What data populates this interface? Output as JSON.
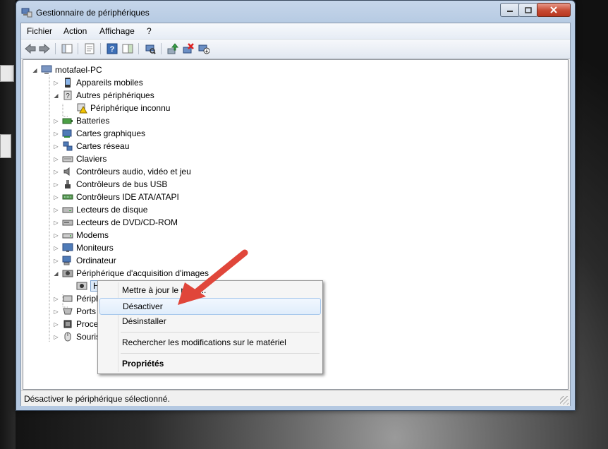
{
  "window": {
    "title": "Gestionnaire de périphériques"
  },
  "menubar": [
    "Fichier",
    "Action",
    "Affichage",
    "?"
  ],
  "tree": {
    "root": "motafael-PC",
    "items": [
      {
        "label": "Appareils mobiles",
        "icon": "mobile-device-icon"
      },
      {
        "label": "Autres périphériques",
        "icon": "unknown-device-icon"
      },
      {
        "label": "Périphérique inconnu",
        "icon": "warning-device-icon"
      },
      {
        "label": "Batteries",
        "icon": "battery-icon"
      },
      {
        "label": "Cartes graphiques",
        "icon": "display-adapter-icon"
      },
      {
        "label": "Cartes réseau",
        "icon": "network-adapter-icon"
      },
      {
        "label": "Claviers",
        "icon": "keyboard-icon"
      },
      {
        "label": "Contrôleurs audio, vidéo et jeu",
        "icon": "speaker-icon"
      },
      {
        "label": "Contrôleurs de bus USB",
        "icon": "usb-icon"
      },
      {
        "label": "Contrôleurs IDE ATA/ATAPI",
        "icon": "ide-controller-icon"
      },
      {
        "label": "Lecteurs de disque",
        "icon": "disk-drive-icon"
      },
      {
        "label": "Lecteurs de DVD/CD-ROM",
        "icon": "dvd-drive-icon"
      },
      {
        "label": "Modems",
        "icon": "modem-icon"
      },
      {
        "label": "Moniteurs",
        "icon": "monitor-icon"
      },
      {
        "label": "Ordinateur",
        "icon": "computer-icon"
      },
      {
        "label": "Périphérique d'acquisition d'images",
        "icon": "camera-icon"
      },
      {
        "label": "HD W",
        "icon": "webcam-icon"
      },
      {
        "label": "Périphé",
        "icon": "hid-icon"
      },
      {
        "label": "Ports (CO",
        "icon": "port-icon"
      },
      {
        "label": "Processe",
        "icon": "processor-icon"
      },
      {
        "label": "Souris et",
        "icon": "mouse-icon"
      }
    ]
  },
  "context_menu": {
    "update": "Mettre à jour le pi...e...",
    "disable": "Désactiver",
    "uninstall": "Désinstaller",
    "scan": "Rechercher les modifications sur le matériel",
    "properties": "Propriétés"
  },
  "statusbar": {
    "text": "Désactiver le périphérique sélectionné."
  },
  "colors": {
    "annotation_arrow": "#e0463a",
    "selection": "#dce9f7"
  }
}
